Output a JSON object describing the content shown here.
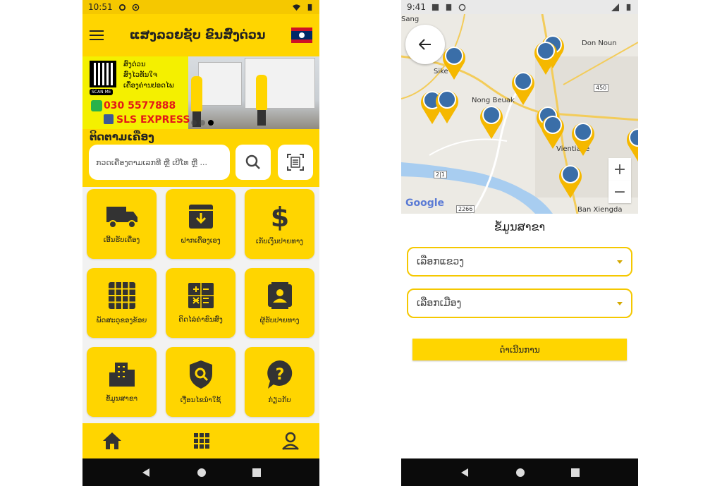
{
  "left_screen": {
    "status_bar": {
      "time": "10:51"
    },
    "app_title": "ແສງລວຍຊັບ ຂົນສົ່ງດ່ວນ",
    "banner": {
      "qr_label": "SCAN ME",
      "tagline_1": "ສົ່ງດ່ວນ",
      "tagline_2": "ສົ່ງໄວທັນໃຈ",
      "tagline_3": "ເຄື່ອງຄ່ານປອດໄພ",
      "phone": "030 5577888",
      "brand": "SLS EXPRESS"
    },
    "tracking": {
      "label": "ຕິດຕາມເຄື່ອງ",
      "placeholder": "ກວດເຄື່ອງຕາມເລກທີ ຫຼື ເບີໂທ ຫຼື ..."
    },
    "tiles": [
      {
        "label": "ເອີ້ນຮັບເຄື່ອງ",
        "icon": "truck-icon"
      },
      {
        "label": "ຝາກເຄື່ອງເອງ",
        "icon": "archive-icon"
      },
      {
        "label": "ເກັບເງິນປາຍທາງ",
        "icon": "dollar-icon"
      },
      {
        "label": "ພັດສະດຸຂອງຂ້ອຍ",
        "icon": "grid-icon"
      },
      {
        "label": "ຄິດໄລ່ຄ່າຂົນສົ່ງ",
        "icon": "calculator-icon"
      },
      {
        "label": "ຜູ້ຮັບປາຍທາງ",
        "icon": "contact-icon"
      },
      {
        "label": "ຂໍ້ມູນສາຂາ",
        "icon": "building-icon"
      },
      {
        "label": "ເງື່ອນໄຂນຳໃຊ້",
        "icon": "shield-search-icon"
      },
      {
        "label": "ກ່ຽວກັບ",
        "icon": "help-icon"
      }
    ]
  },
  "right_screen": {
    "status_bar": {
      "time": "9:41"
    },
    "map": {
      "labels": [
        "Sang",
        "Don Noun",
        "Sike",
        "Nong Beuak",
        "Vientiane",
        "Ban Xiengda"
      ],
      "road_numbers": [
        "450",
        "2|1",
        "2266"
      ],
      "attribution": "Google"
    },
    "title": "ຂໍ້ມູນສາຂາ",
    "province_select": "ເລືອກແຂວງ",
    "district_select": "ເລືອກເມືອງ",
    "proceed_button": "ດຳເນີນການ"
  },
  "colors": {
    "primary": "#ffd500",
    "icon": "#333333",
    "accent_red": "#e31818"
  }
}
